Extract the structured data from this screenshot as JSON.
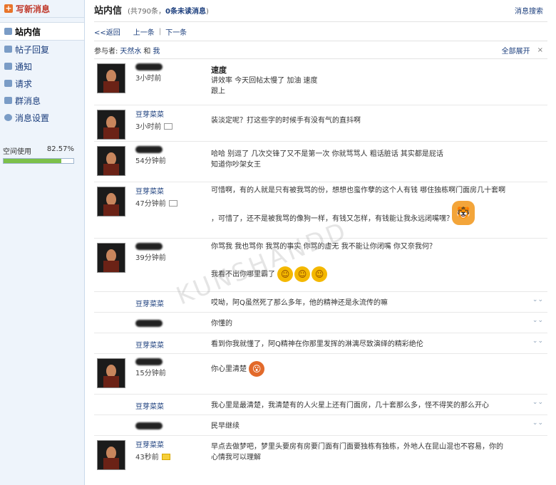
{
  "sidebar": {
    "compose_label": "写新消息",
    "items": [
      {
        "label": "站内信",
        "icon": "envelope-icon",
        "active": true
      },
      {
        "label": "帖子回复",
        "icon": "reply-icon"
      },
      {
        "label": "通知",
        "icon": "notify-icon"
      },
      {
        "label": "请求",
        "icon": "request-icon"
      },
      {
        "label": "群消息",
        "icon": "group-icon"
      },
      {
        "label": "消息设置",
        "icon": "settings-icon"
      }
    ],
    "space_label": "空间使用",
    "space_value": "82.57%",
    "space_fraction": 0.8257
  },
  "header": {
    "title": "站内信",
    "count_prefix": "(共790条，",
    "unread": "0条未读消息",
    "count_suffix": ")",
    "search": "消息搜索"
  },
  "toolbar": {
    "back": "<<返回",
    "prev": "上一条",
    "sep": "|",
    "next": "下一条"
  },
  "participants": {
    "label": "参与者:",
    "name1": "天然水",
    "and": "和",
    "name2": "我",
    "expand": "全部展开",
    "close": "×"
  },
  "messages": [
    {
      "sender": "",
      "time": "3小时前",
      "subject": "速度",
      "lines": [
        "讲效率 今天回帖太慢了 加油 速度",
        "跟上"
      ]
    },
    {
      "sender": "豆芽菜菜",
      "time": "3小时前",
      "lines": [
        "装淡定呢？打这些字的时候手有没有气的直抖啊"
      ]
    },
    {
      "sender": "",
      "time": "54分钟前",
      "lines": [
        "哈哈 别逗了 几次交锋了又不是第一次  你就骂骂人 粗话脏话 其实都是屁话",
        "知道你吵架女王"
      ]
    },
    {
      "sender": "豆芽菜菜",
      "time": "47分钟前",
      "lines": [
        "可惜啊，有的人就是只有被我骂的份，想想也蛮作孽的这个人有钱 哪住独栋啊门面房几十套啊",
        "，可惜了，还不是被我骂的像狗一样，有钱又怎样，有钱能让我永远闭嘴嘿？"
      ]
    },
    {
      "sender": "",
      "time": "39分钟前",
      "lines": [
        "你骂我 我也骂你 我骂的事实 你骂的虚无 我不能让你闭嘴 你又奈我何？",
        "我看不出你哪里霸了"
      ]
    },
    {
      "sender": "豆芽菜菜",
      "time": "",
      "lines": [
        "哎呦，阿Q虽然死了那么多年，他的精神还是永流传的嘛"
      ]
    },
    {
      "sender": "",
      "time": "",
      "lines": [
        "你懂的"
      ]
    },
    {
      "sender": "豆芽菜菜",
      "time": "",
      "lines": [
        "看到你我就懂了，阿Q精神在你那里发挥的淋漓尽致演绎的精彩绝伦"
      ]
    },
    {
      "sender": "",
      "time": "15分钟前",
      "lines": [
        "你心里清楚"
      ]
    },
    {
      "sender": "豆芽菜菜",
      "time": "",
      "lines": [
        "我心里是最清楚，我清楚有的人火星上还有门面房，几十套那么多，怪不得笑的那么开心"
      ]
    },
    {
      "sender": "",
      "time": "",
      "lines": [
        "民早继续"
      ]
    },
    {
      "sender": "豆芽菜菜",
      "time": "43秒前",
      "lines": [
        "早点去做梦吧，梦里头要房有房要门面有门面要独栋有独栋，外地人在昆山混也不容易，你的",
        "心情我可以理解"
      ]
    }
  ],
  "watermark": "KUNSHANDD",
  "colors": {
    "accent": "#1a3d7c",
    "compose": "#e8742a",
    "space_fill": "#7cc04a"
  }
}
